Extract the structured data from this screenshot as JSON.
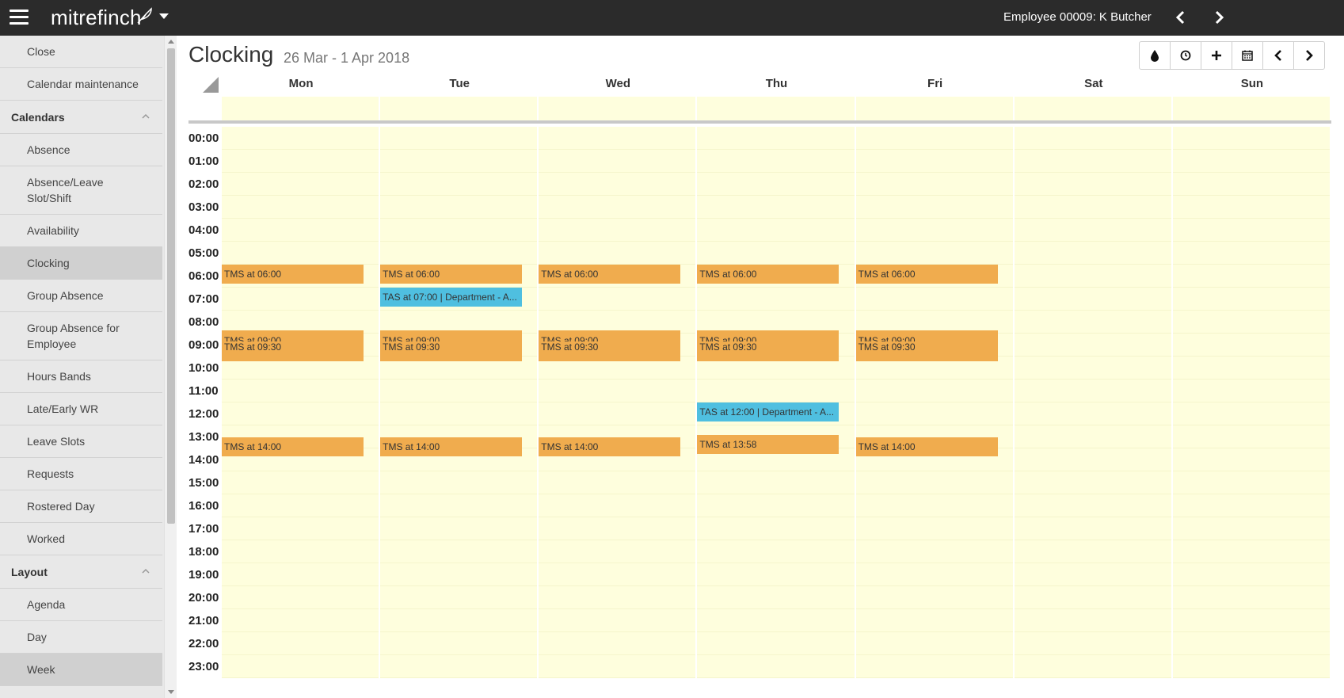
{
  "topbar": {
    "brand": "mitrefinch",
    "employee": "Employee 00009: K Butcher"
  },
  "sidebar": {
    "items_top": [
      {
        "label": "Close"
      },
      {
        "label": "Calendar maintenance"
      }
    ],
    "calendars_header": "Calendars",
    "calendars": [
      {
        "label": "Absence"
      },
      {
        "label": "Absence/Leave Slot/Shift"
      },
      {
        "label": "Availability"
      },
      {
        "label": "Clocking"
      },
      {
        "label": "Group Absence"
      },
      {
        "label": "Group Absence for Employee"
      },
      {
        "label": "Hours Bands"
      },
      {
        "label": "Late/Early WR"
      },
      {
        "label": "Leave Slots"
      },
      {
        "label": "Requests"
      },
      {
        "label": "Rostered Day"
      },
      {
        "label": "Worked"
      }
    ],
    "layout_header": "Layout",
    "layout": [
      {
        "label": "Agenda"
      },
      {
        "label": "Day"
      },
      {
        "label": "Week"
      }
    ]
  },
  "page": {
    "title": "Clocking",
    "range": "26 Mar - 1 Apr 2018"
  },
  "toolbar": [
    "drop-icon",
    "clock-icon",
    "plus-icon",
    "calendar-icon",
    "chevron-left-icon",
    "chevron-right-icon"
  ],
  "calendar": {
    "days": [
      "Mon",
      "Tue",
      "Wed",
      "Thu",
      "Fri",
      "Sat",
      "Sun"
    ],
    "hours": [
      "00:00",
      "01:00",
      "02:00",
      "03:00",
      "04:00",
      "05:00",
      "06:00",
      "07:00",
      "08:00",
      "09:00",
      "10:00",
      "11:00",
      "12:00",
      "13:00",
      "14:00",
      "15:00",
      "16:00",
      "17:00",
      "18:00",
      "19:00",
      "20:00",
      "21:00",
      "22:00",
      "23:00"
    ],
    "events": {
      "mon_0600": "TMS at 06:00",
      "mon_0900": "TMS at 09:00",
      "mon_0930": "TMS at 09:30",
      "mon_1400": "TMS at 14:00",
      "tue_0600": "TMS at 06:00",
      "tue_0700": "TAS at 07:00 | Department - A...",
      "tue_0900": "TMS at 09:00",
      "tue_0930": "TMS at 09:30",
      "tue_1400": "TMS at 14:00",
      "wed_0600": "TMS at 06:00",
      "wed_0900": "TMS at 09:00",
      "wed_0930": "TMS at 09:30",
      "wed_1400": "TMS at 14:00",
      "thu_0600": "TMS at 06:00",
      "thu_0900": "TMS at 09:00",
      "thu_0930": "TMS at 09:30",
      "thu_1200": "TAS at 12:00 | Department - A...",
      "thu_1358": "TMS at 13:58",
      "fri_0600": "TMS at 06:00",
      "fri_0900": "TMS at 09:00",
      "fri_0930": "TMS at 09:30",
      "fri_1400": "TMS at 14:00"
    }
  },
  "colors": {
    "topbar": "#2b2b2b",
    "tms": "#f0ac4e",
    "tas": "#4fbfe0",
    "grid": "#fefedd"
  }
}
